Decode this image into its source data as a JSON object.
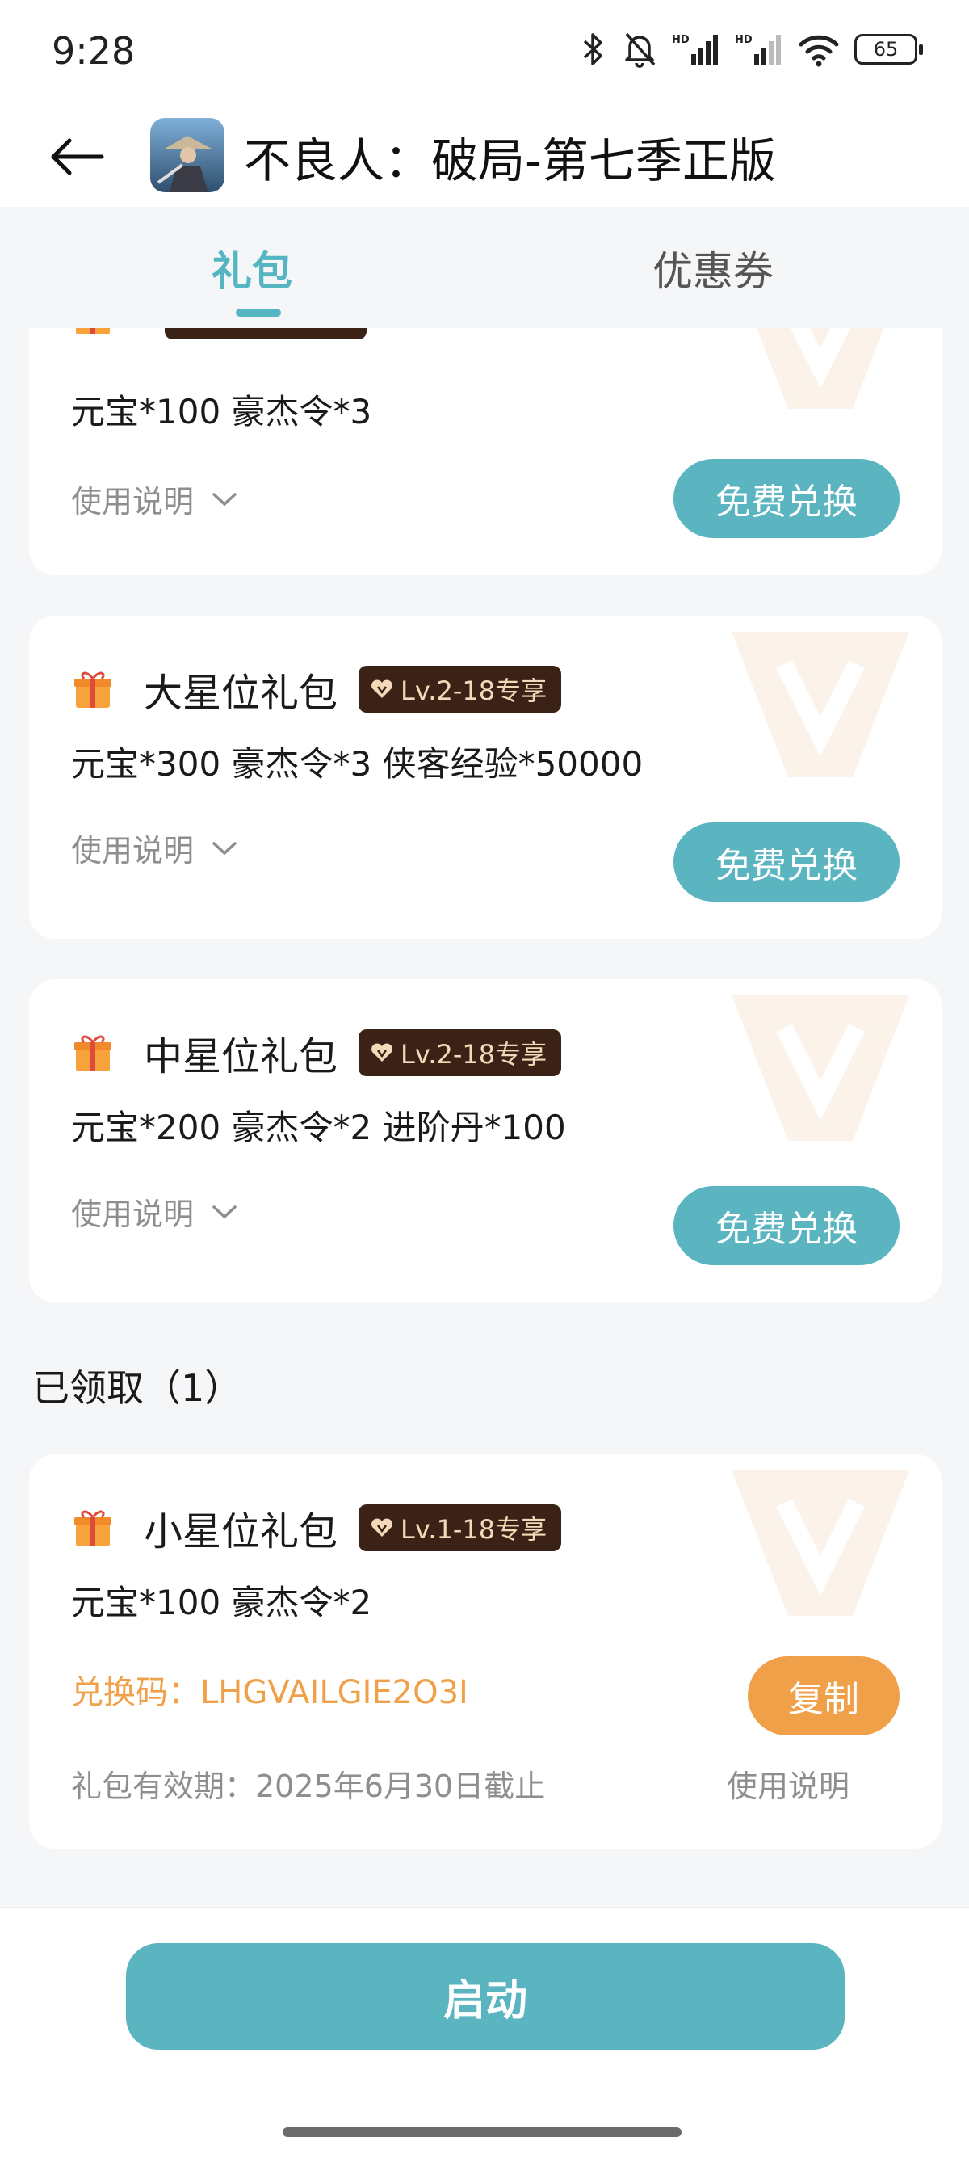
{
  "status_bar": {
    "time": "9:28",
    "battery": "65",
    "icons": [
      "bluetooth-icon",
      "mute-bell-icon",
      "signal-hd-icon",
      "signal-hd-icon",
      "wifi-icon",
      "battery-icon"
    ]
  },
  "header": {
    "back_icon": "arrow-left-icon",
    "app_title": "不良人：破局-第七季正版"
  },
  "tabs": [
    {
      "label": "礼包",
      "active": true
    },
    {
      "label": "优惠券",
      "active": false
    }
  ],
  "gifts": [
    {
      "title": "",
      "level": "",
      "items": "元宝*100 豪杰令*3",
      "usage_label": "使用说明",
      "button": "免费兑换"
    },
    {
      "title": "大星位礼包",
      "level": "Lv.2-18专享",
      "items": "元宝*300 豪杰令*3 侠客经验*50000",
      "usage_label": "使用说明",
      "button": "免费兑换"
    },
    {
      "title": "中星位礼包",
      "level": "Lv.2-18专享",
      "items": "元宝*200 豪杰令*2 进阶丹*100",
      "usage_label": "使用说明",
      "button": "免费兑换"
    }
  ],
  "claimed_section": {
    "title": "已领取（1）",
    "gift": {
      "title": "小星位礼包",
      "level": "Lv.1-18专享",
      "items": "元宝*100 豪杰令*2",
      "code_line": "兑换码：LHGVAILGIE2O3I",
      "copy_button": "复制",
      "validity": "礼包有效期：2025年6月30日截止",
      "usage_label": "使用说明"
    }
  },
  "launch_button": "启动",
  "colors": {
    "accent": "#5ab5c1",
    "orange": "#f0a048",
    "badge_bg": "#3a2216",
    "badge_text": "#f4d9b8"
  }
}
